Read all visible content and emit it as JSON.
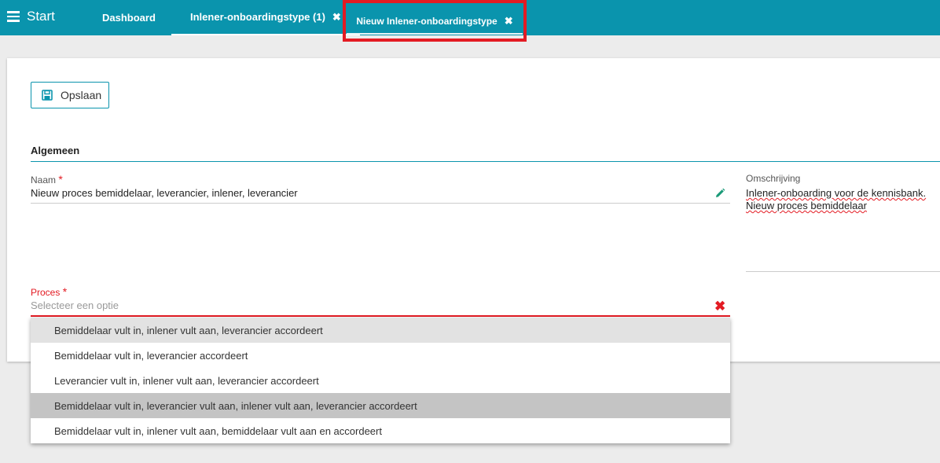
{
  "topbar": {
    "start_label": "Start",
    "tabs": [
      {
        "label": "Dashboard"
      },
      {
        "label": "Inlener-onboardingstype (1)",
        "close": "✖"
      },
      {
        "label": "Nieuw Inlener-onboardingstype",
        "close": "✖"
      }
    ],
    "highlight_color": "#e31b23",
    "bar_color": "#0a94ad"
  },
  "toolbar": {
    "save_label": "Opslaan",
    "save_icon": "floppy-disk-icon"
  },
  "section": {
    "title": "Algemeen"
  },
  "form": {
    "naam": {
      "label": "Naam",
      "required": "*",
      "value": "Nieuw proces bemiddelaar, leverancier, inlener, leverancier"
    },
    "omschrijving": {
      "label": "Omschrijving",
      "line1": "Inlener-onboarding voor de kennisbank.",
      "line2": "Nieuw proces bemiddelaar"
    },
    "proces": {
      "label": "Proces",
      "required": "*",
      "placeholder": "Selecteer een optie",
      "clear": "✖",
      "options": [
        "Bemiddelaar vult in, inlener vult aan, leverancier accordeert",
        "Bemiddelaar vult in, leverancier accordeert",
        "Leverancier vult in, inlener vult aan, leverancier accordeert",
        "Bemiddelaar vult in, leverancier vult aan, inlener vult aan, leverancier accordeert",
        "Bemiddelaar vult in, inlener vult aan, bemiddelaar vult aan en accordeert"
      ]
    }
  }
}
